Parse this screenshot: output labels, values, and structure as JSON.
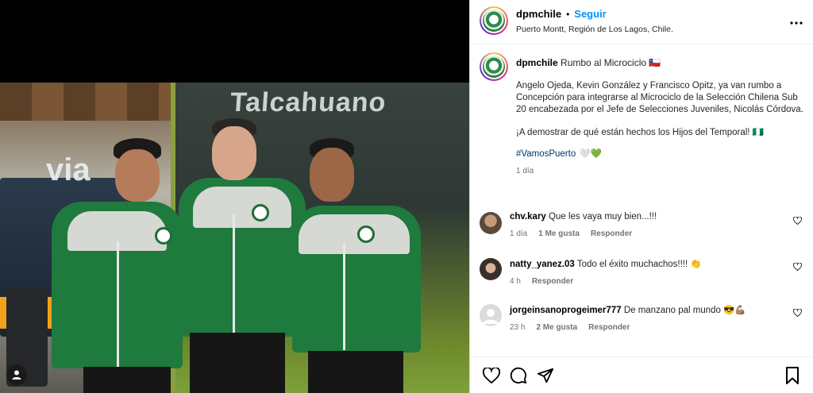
{
  "post": {
    "username": "dpmchile",
    "separator": "•",
    "follow_label": "Seguir",
    "location": "Puerto Montt, Región de Los Lagos, Chile.",
    "more_icon": "more-horizontal-icon"
  },
  "caption": {
    "username": "dpmchile",
    "title": "Rumbo al Microciclo 🇨🇱",
    "paragraph1": "Angelo Ojeda, Kevin González y Francisco Opitz, ya van rumbo a Concepción para integrarse al Microciclo de la Selección Chilena Sub 20 encabezada por el Jefe de Selecciones Juveniles, Nicolás Córdova.",
    "paragraph2": "¡A demostrar de qué están hechos los Hijos del Temporal! 🇳🇬",
    "hashtag": "#VamosPuerto",
    "hearts": "🤍💚",
    "age": "1 día"
  },
  "comments": [
    {
      "username": "chv.kary",
      "text": "Que les vaya muy bien...!!!",
      "time": "1 día",
      "likes": "1 Me gusta",
      "reply": "Responder"
    },
    {
      "username": "natty_yanez.03",
      "text": "Todo el éxito muchachos!!!! 👏",
      "time": "4 h",
      "likes": "",
      "reply": "Responder"
    },
    {
      "username": "jorgeinsanoprogeimer777",
      "text": "De manzano pal mundo 😎💪🏽",
      "time": "23 h",
      "likes": "2 Me gusta",
      "reply": "Responder"
    }
  ],
  "photo": {
    "bus_sign": "Talcahuano",
    "bus_logo": "via"
  },
  "actions": [
    "like-icon",
    "comment-icon",
    "share-icon",
    "save-icon"
  ],
  "colors": {
    "follow": "#0095f6",
    "jacket": "#1f7a3d",
    "heart_green": "#11c16a"
  }
}
